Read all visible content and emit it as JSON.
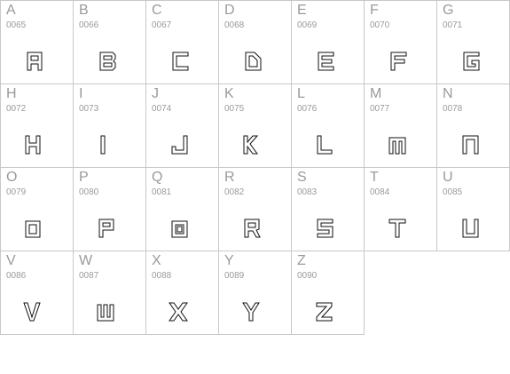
{
  "characters": [
    {
      "letter": "A",
      "code": "0065",
      "glyph": "A-glyph-icon"
    },
    {
      "letter": "B",
      "code": "0066",
      "glyph": "B-glyph-icon"
    },
    {
      "letter": "C",
      "code": "0067",
      "glyph": "C-glyph-icon"
    },
    {
      "letter": "D",
      "code": "0068",
      "glyph": "D-glyph-icon"
    },
    {
      "letter": "E",
      "code": "0069",
      "glyph": "E-glyph-icon"
    },
    {
      "letter": "F",
      "code": "0070",
      "glyph": "F-glyph-icon"
    },
    {
      "letter": "G",
      "code": "0071",
      "glyph": "G-glyph-icon"
    },
    {
      "letter": "H",
      "code": "0072",
      "glyph": "H-glyph-icon"
    },
    {
      "letter": "I",
      "code": "0073",
      "glyph": "I-glyph-icon"
    },
    {
      "letter": "J",
      "code": "0074",
      "glyph": "J-glyph-icon"
    },
    {
      "letter": "K",
      "code": "0075",
      "glyph": "K-glyph-icon"
    },
    {
      "letter": "L",
      "code": "0076",
      "glyph": "L-glyph-icon"
    },
    {
      "letter": "M",
      "code": "0077",
      "glyph": "M-glyph-icon"
    },
    {
      "letter": "N",
      "code": "0078",
      "glyph": "N-glyph-icon"
    },
    {
      "letter": "O",
      "code": "0079",
      "glyph": "O-glyph-icon"
    },
    {
      "letter": "P",
      "code": "0080",
      "glyph": "P-glyph-icon"
    },
    {
      "letter": "Q",
      "code": "0081",
      "glyph": "Q-glyph-icon"
    },
    {
      "letter": "R",
      "code": "0082",
      "glyph": "R-glyph-icon"
    },
    {
      "letter": "S",
      "code": "0083",
      "glyph": "S-glyph-icon"
    },
    {
      "letter": "T",
      "code": "0084",
      "glyph": "T-glyph-icon"
    },
    {
      "letter": "U",
      "code": "0085",
      "glyph": "U-glyph-icon"
    },
    {
      "letter": "V",
      "code": "0086",
      "glyph": "V-glyph-icon"
    },
    {
      "letter": "W",
      "code": "0087",
      "glyph": "W-glyph-icon"
    },
    {
      "letter": "X",
      "code": "0088",
      "glyph": "X-glyph-icon"
    },
    {
      "letter": "Y",
      "code": "0089",
      "glyph": "Y-glyph-icon"
    },
    {
      "letter": "Z",
      "code": "0090",
      "glyph": "Z-glyph-icon"
    }
  ],
  "colors": {
    "label": "#9a9a9a",
    "grid_line": "#c8c8c8",
    "glyph_outline": "#111111"
  }
}
